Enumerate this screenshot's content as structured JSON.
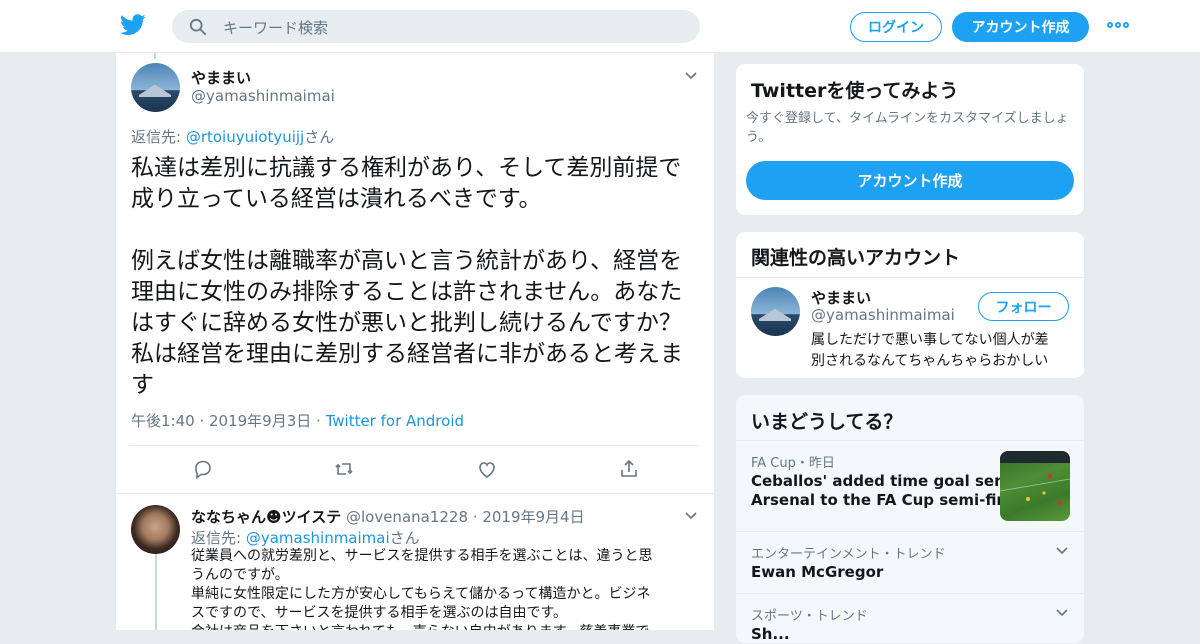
{
  "header": {
    "search_placeholder": "キーワード検索",
    "login_label": "ログイン",
    "signup_label": "アカウント作成",
    "brand_color": "#1da1f2"
  },
  "tweet": {
    "display_name": "やままい",
    "handle": "@yamashinmaimai",
    "reply_prefix": "返信先: ",
    "reply_target": "@rtoiuyuiotyuijj",
    "reply_suffix": "さん",
    "text": "私達は差別に抗議する権利があり、そして差別前提で\n成り立っている経営は潰れるべきです。\n\n例えば女性は離職率が高いと言う統計があり、経営を\n理由に女性のみ排除することは許されません。あなた\nはすぐに辞める女性が悪いと批判し続けるんですか？\n私は経営を理由に差別する経営者に非があると考えま\nす",
    "time": "午後1:40",
    "date": "2019年9月3日",
    "source": "Twitter for Android"
  },
  "reply": {
    "display_name": "ななちゃん☻ツイステ",
    "handle": "@lovenana1228",
    "date": "2019年9月4日",
    "reply_prefix": "返信先: ",
    "reply_target": "@yamashinmaimai",
    "reply_suffix": "さん",
    "text": "従業員への就労差別と、サービスを提供する相手を選ぶことは、違うと思\nうんのですが。\n単純に女性限定にした方が安心してもらえて儲かるって構造かと。ビジネ\nスですので、サービスを提供する相手を選ぶのは自由です。\n会社は商品を下さいと言われても、売らない自由があります。慈善事業で"
  },
  "signup_card": {
    "title": "Twitterを使ってみよう",
    "subtitle": "今すぐ登録して、タイムラインをカスタマイズしましょ\nう。",
    "button_label": "アカウント作成"
  },
  "related": {
    "title": "関連性の高いアカウント",
    "display_name": "やままい",
    "handle": "@yamashinmaimai",
    "follow_label": "フォロー",
    "bio": "属しただけで悪い事してない個人が差\n別されるなんてちゃんちゃらおかしい"
  },
  "trends": {
    "title": "いまどうしてる？",
    "items": [
      {
        "category": "FA Cup・昨日",
        "title": "Ceballos' added time goal sends\nArsenal to the FA Cup semi-finals"
      },
      {
        "category": "エンターテインメント・トレンド",
        "title": "Ewan McGregor"
      },
      {
        "category": "スポーツ・トレンド",
        "title": "Sh..."
      }
    ]
  }
}
